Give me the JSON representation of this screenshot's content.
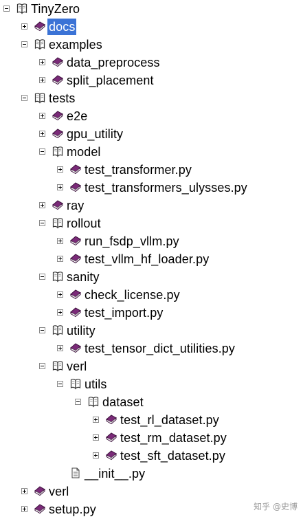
{
  "tree": {
    "rows": [
      {
        "label": "TinyZero",
        "type": "open-book",
        "state": "open",
        "level": 0
      },
      {
        "label": "docs",
        "type": "closed-book",
        "state": "closed",
        "level": 1,
        "selected": true
      },
      {
        "label": "examples",
        "type": "open-book",
        "state": "open",
        "level": 1
      },
      {
        "label": "data_preprocess",
        "type": "closed-book",
        "state": "closed",
        "level": 2
      },
      {
        "label": "split_placement",
        "type": "closed-book",
        "state": "closed",
        "level": 2
      },
      {
        "label": "tests",
        "type": "open-book",
        "state": "open",
        "level": 1
      },
      {
        "label": "e2e",
        "type": "closed-book",
        "state": "closed",
        "level": 2
      },
      {
        "label": "gpu_utility",
        "type": "closed-book",
        "state": "closed",
        "level": 2
      },
      {
        "label": "model",
        "type": "open-book",
        "state": "open",
        "level": 2
      },
      {
        "label": "test_transformer.py",
        "type": "closed-book",
        "state": "closed",
        "level": 3
      },
      {
        "label": "test_transformers_ulysses.py",
        "type": "closed-book",
        "state": "closed",
        "level": 3
      },
      {
        "label": "ray",
        "type": "closed-book",
        "state": "closed",
        "level": 2
      },
      {
        "label": "rollout",
        "type": "open-book",
        "state": "open",
        "level": 2
      },
      {
        "label": "run_fsdp_vllm.py",
        "type": "closed-book",
        "state": "closed",
        "level": 3
      },
      {
        "label": "test_vllm_hf_loader.py",
        "type": "closed-book",
        "state": "closed",
        "level": 3
      },
      {
        "label": "sanity",
        "type": "open-book",
        "state": "open",
        "level": 2
      },
      {
        "label": "check_license.py",
        "type": "closed-book",
        "state": "closed",
        "level": 3
      },
      {
        "label": "test_import.py",
        "type": "closed-book",
        "state": "closed",
        "level": 3
      },
      {
        "label": "utility",
        "type": "open-book",
        "state": "open",
        "level": 2
      },
      {
        "label": "test_tensor_dict_utilities.py",
        "type": "closed-book",
        "state": "closed",
        "level": 3
      },
      {
        "label": "verl",
        "type": "open-book",
        "state": "open",
        "level": 2
      },
      {
        "label": "utils",
        "type": "open-book",
        "state": "open",
        "level": 3
      },
      {
        "label": "dataset",
        "type": "open-book",
        "state": "open",
        "level": 4
      },
      {
        "label": "test_rl_dataset.py",
        "type": "closed-book",
        "state": "closed",
        "level": 5
      },
      {
        "label": "test_rm_dataset.py",
        "type": "closed-book",
        "state": "closed",
        "level": 5
      },
      {
        "label": "test_sft_dataset.py",
        "type": "closed-book",
        "state": "closed",
        "level": 5
      },
      {
        "label": "__init__.py",
        "type": "page",
        "state": "leaf",
        "level": 3
      },
      {
        "label": "verl",
        "type": "closed-book",
        "state": "closed",
        "level": 1
      },
      {
        "label": "setup.py",
        "type": "closed-book",
        "state": "closed",
        "level": 1
      }
    ]
  },
  "watermark": "知乎 @史博",
  "colors": {
    "book": "#7a2a78",
    "selected": "#3b73d6"
  }
}
